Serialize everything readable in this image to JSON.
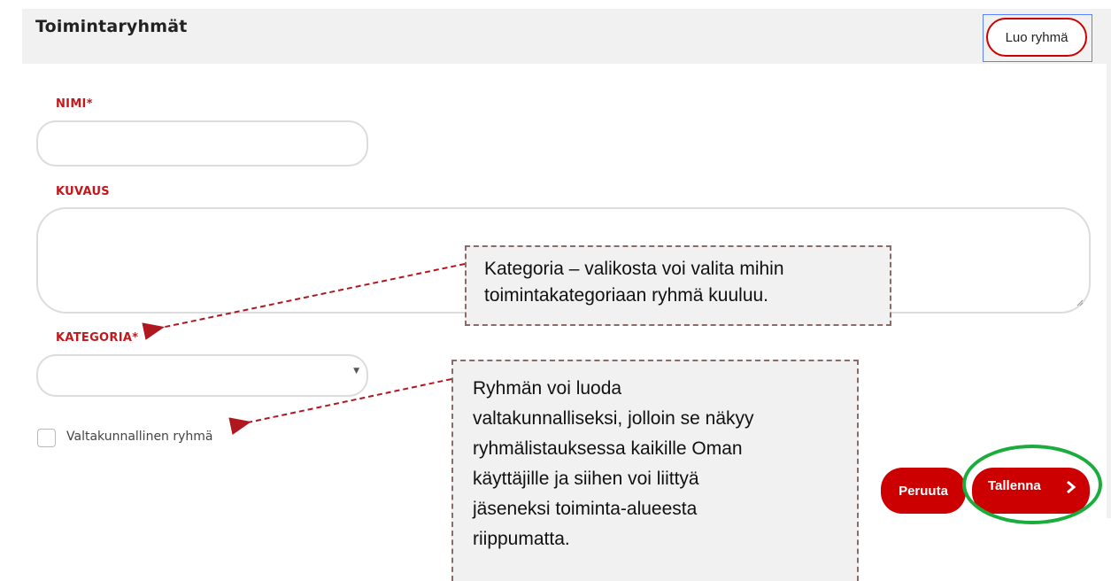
{
  "header": {
    "title": "Toimintaryhmät",
    "create_button": "Luo ryhmä"
  },
  "form": {
    "name_label": "NIMI*",
    "name_value": "",
    "description_label": "KUVAUS",
    "description_value": "",
    "category_label": "KATEGORIA*",
    "category_selected": "",
    "national_checkbox_label": "Valtakunnallinen ryhmä",
    "national_checked": false,
    "cancel_button": "Peruuta",
    "save_button": "Tallenna"
  },
  "callouts": {
    "category": {
      "line1": "Kategoria – valikosta voi valita mihin",
      "line2": "toimintakategoriaan ryhmä kuuluu."
    },
    "national": {
      "line1": "Ryhmän voi luoda",
      "line2": "valtakunnalliseksi, jolloin se näkyy",
      "line3": "ryhmälistauksessa kaikille Oman",
      "line4": "käyttäjille ja siihen voi liittyä",
      "line5": "jäseneksi toiminta-alueesta",
      "line6": "riippumatta."
    }
  },
  "icons": {
    "dropdown": "chevron-down-icon",
    "save": "chevron-right-icon",
    "resize": "resize-grip-icon"
  },
  "colors": {
    "accent_red": "#cc0000",
    "label_red": "#c2181b",
    "highlight_green": "#1aac3c",
    "panel_gray": "#f1f1f1",
    "callout_border": "#8a6b6b",
    "arrow_red": "#b0171f"
  }
}
